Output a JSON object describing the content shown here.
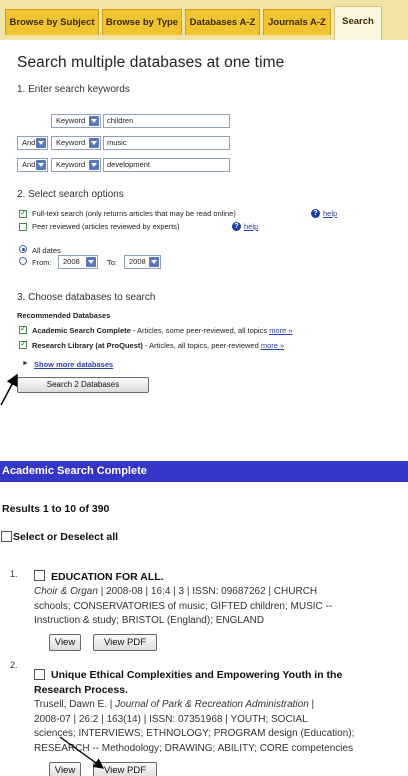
{
  "tabs": [
    "Browse by Subject",
    "Browse by Type",
    "Databases A-Z",
    "Journals A-Z",
    "Search"
  ],
  "heading": "Search multiple databases at one time",
  "step1": "1. Enter search keywords",
  "rows": [
    {
      "bool": "",
      "field": "Keyword",
      "term": "children"
    },
    {
      "bool": "And",
      "field": "Keyword",
      "term": "music"
    },
    {
      "bool": "And",
      "field": "Keyword",
      "term": "development"
    }
  ],
  "step2": "2. Select search options",
  "fulltext": "Full-text search (only returns articles that may be read online)",
  "peer": "Peer reviewed (articles reviewed by experts)",
  "help": "help",
  "all_dates": "All dates",
  "from_label": "From:",
  "from_val": "2008",
  "to_label": "To:",
  "to_val": "2008",
  "step3": "3. Choose databases to search",
  "recommended": "Recommended Databases",
  "db1_name": "Academic Search Complete",
  "db1_desc": " - Articles, some peer-reviewed, all topics ",
  "db2_name": "Research Library (at ProQuest)",
  "db2_desc": " - Articles, all topics, peer-reviewed ",
  "more": "more »",
  "show_more": "Show more databases",
  "search_button": "Search 2 Databases",
  "results_header": "Academic Search Complete",
  "results_count": "Results 1 to 10 of 390",
  "select_all": "Select or Deselect all",
  "results": [
    {
      "num": "1.",
      "title": "EDUCATION FOR ALL.",
      "journal": "Choir & Organ",
      "lines": [
        " | 2008-08 | 16:4 | 3 | ISSN: 09687262 | CHURCH",
        "schools; CONSERVATORIES of music; GIFTED children; MUSIC --",
        "Instruction & study; BRISTOL (England); ENGLAND"
      ]
    },
    {
      "num": "2.",
      "title_lines": [
        "Unique Ethical Complexities and Empowering Youth in the",
        "Research Process."
      ],
      "author": "Trusell, Dawn E. | ",
      "journal": "Journal of Park & Recreation Administration",
      "lines": [
        " |",
        "2008-07 | 26:2 | 163(14) | ISSN: 07351968 | YOUTH; SOCIAL",
        "sciences; INTERVIEWS; ETHNOLOGY; PROGRAM design (Education);",
        "RESEARCH -- Methodology; DRAWING; ABILITY; CORE competencies"
      ]
    }
  ],
  "view": "View",
  "view_pdf": "View PDF"
}
